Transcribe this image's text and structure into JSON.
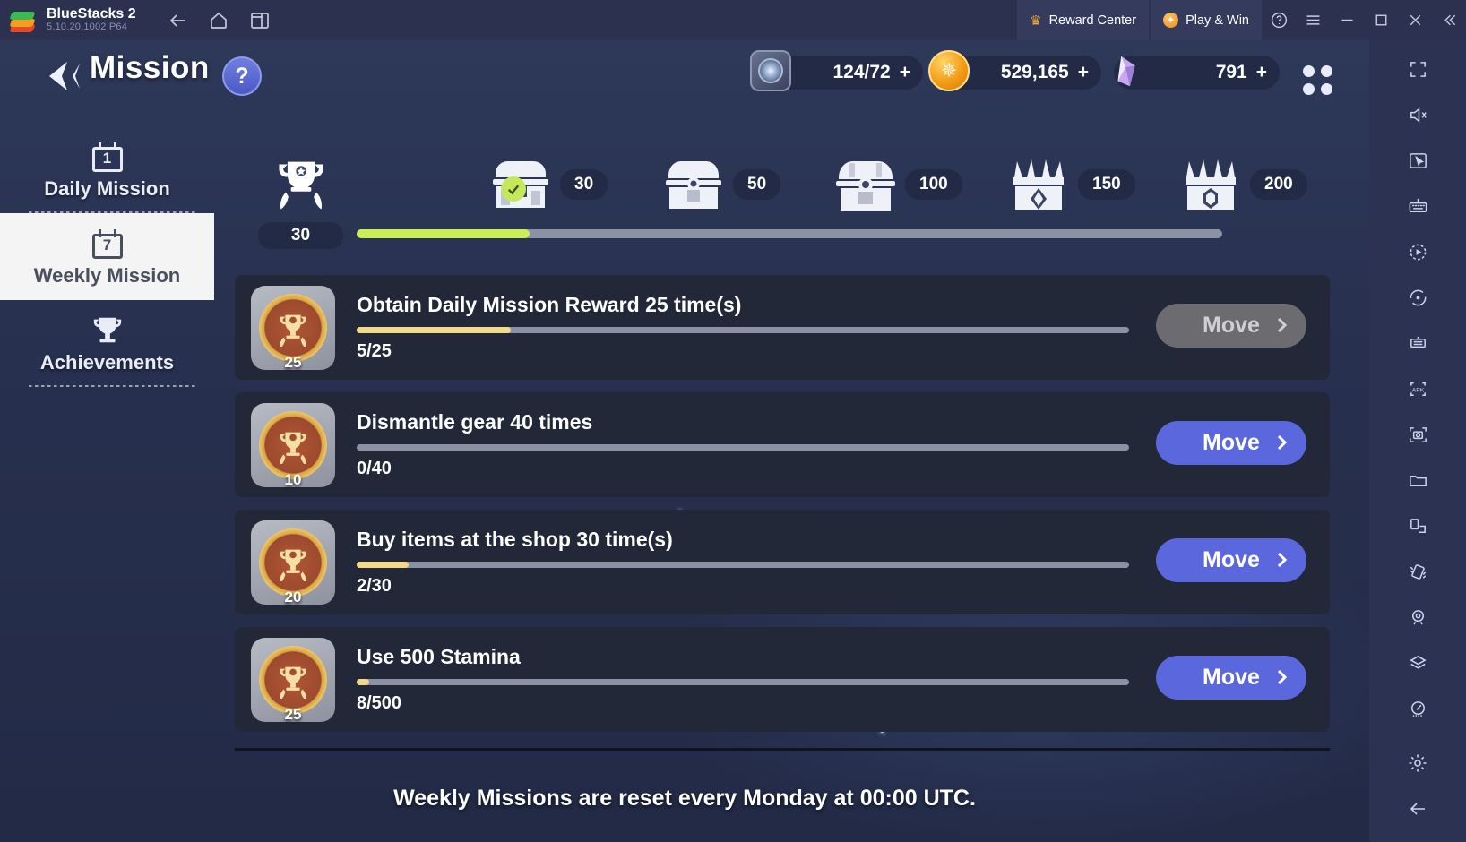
{
  "titlebar": {
    "app_name": "BlueStacks 2",
    "version": "5.10.20.1002  P64",
    "nav_icons": [
      "back-icon",
      "home-icon",
      "multi-instance-icon"
    ],
    "reward_center": "Reward Center",
    "play_and_win": "Play & Win",
    "help": "?",
    "window_controls": [
      "menu-icon",
      "minimize-icon",
      "maximize-icon",
      "close-icon",
      "collapse-icon"
    ]
  },
  "header": {
    "title": "Mission",
    "help_label": "?",
    "currencies": [
      {
        "icon": "compass-icon",
        "value": "124/72",
        "plus": "+"
      },
      {
        "icon": "gold-coin-icon",
        "value": "529,165",
        "plus": "+"
      },
      {
        "icon": "gem-icon",
        "value": "791",
        "plus": "+"
      }
    ]
  },
  "sidebar": {
    "items": [
      {
        "label": "Daily Mission",
        "icon": "calendar-1-icon",
        "badge": "1",
        "active": false
      },
      {
        "label": "Weekly Mission",
        "icon": "calendar-7-icon",
        "badge": "7",
        "active": true
      },
      {
        "label": "Achievements",
        "icon": "trophy-icon",
        "badge": "",
        "active": false
      }
    ]
  },
  "track": {
    "current_points": "30",
    "progress_percent": 20,
    "nodes": [
      {
        "value": "30",
        "claimed": true,
        "tier": "basic"
      },
      {
        "value": "50",
        "claimed": false,
        "tier": "basic"
      },
      {
        "value": "100",
        "claimed": false,
        "tier": "silver"
      },
      {
        "value": "150",
        "claimed": false,
        "tier": "gold"
      },
      {
        "value": "200",
        "claimed": false,
        "tier": "platinum"
      }
    ]
  },
  "missions": [
    {
      "points": "25",
      "text": "Obtain Daily Mission Reward 25 time(s)",
      "count": "5/25",
      "progress_percent": 20,
      "button": "Move",
      "disabled": true
    },
    {
      "points": "10",
      "text": "Dismantle gear 40 times",
      "count": "0/40",
      "progress_percent": 0,
      "button": "Move",
      "disabled": false
    },
    {
      "points": "20",
      "text": "Buy items at the shop 30 time(s)",
      "count": "2/30",
      "progress_percent": 6.7,
      "button": "Move",
      "disabled": false
    },
    {
      "points": "25",
      "text": "Use 500 Stamina",
      "count": "8/500",
      "progress_percent": 1.6,
      "button": "Move",
      "disabled": false
    }
  ],
  "footnote": "Weekly Missions are reset every Monday at 00:00 UTC.",
  "right_toolbar": {
    "icons": [
      "fullscreen-icon",
      "mute-icon",
      "cursor-icon",
      "keyboard-icon",
      "macro-play-icon",
      "sync-icon",
      "script-icon",
      "install-apk-icon",
      "screenshot-icon",
      "folder-icon",
      "rotate-icon",
      "shake-icon",
      "location-icon",
      "layers-icon",
      "eco-mode-icon",
      "settings-icon",
      "back-icon"
    ]
  },
  "colors": {
    "accent_blue": "#5b68dd",
    "track_green": "#cbee58",
    "bar_gold": "#f3d98a",
    "panel_dark": "#222838",
    "game_bg": "#27304e"
  }
}
